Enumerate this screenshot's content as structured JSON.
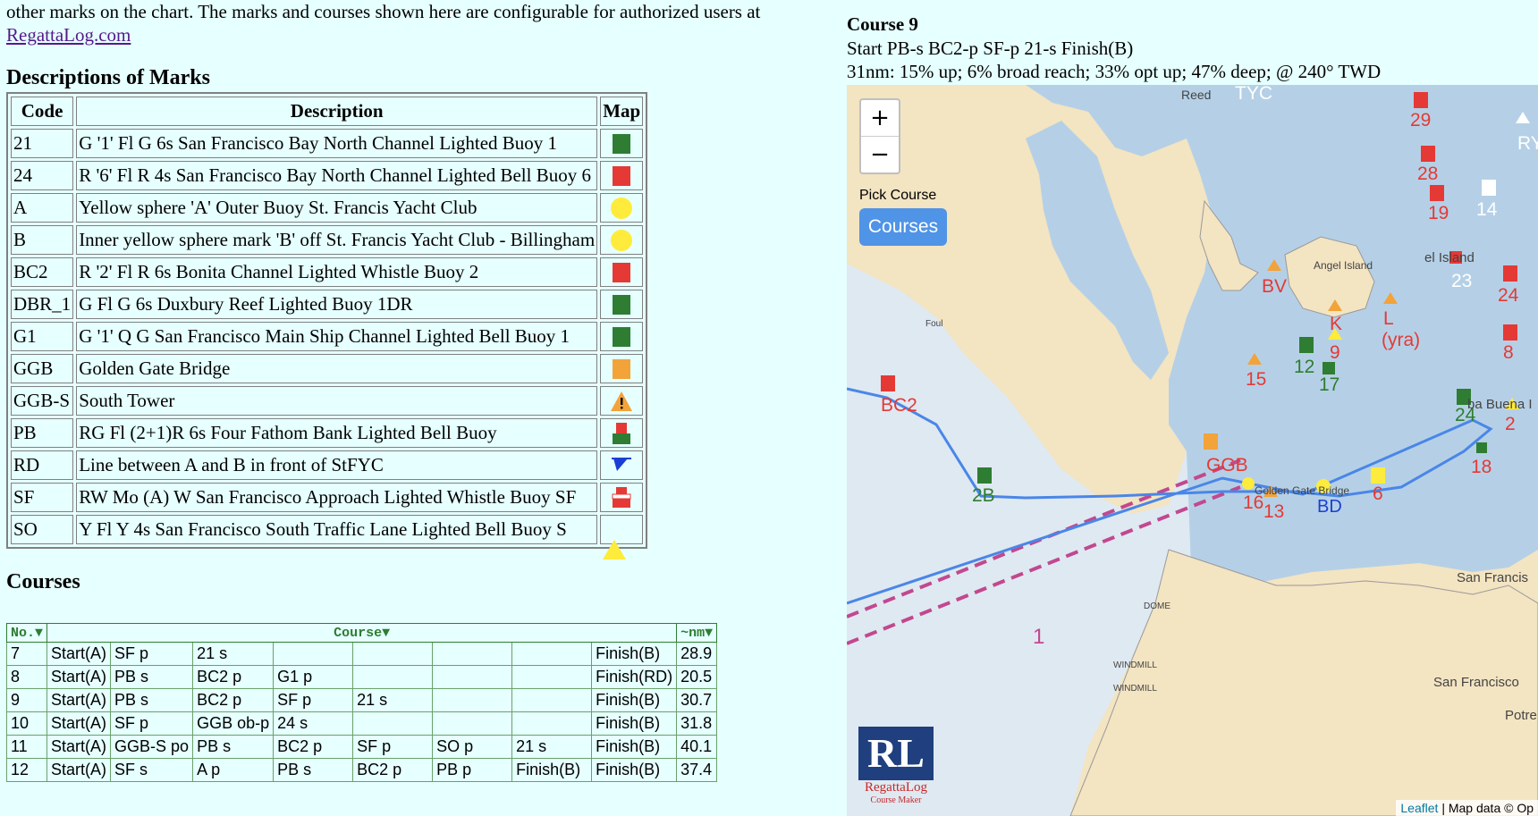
{
  "intro": {
    "line1": "other marks on the chart. The marks and courses shown here are configurable for authorized users at",
    "link": "RegattaLog.com"
  },
  "marks": {
    "heading": "Descriptions of Marks",
    "headers": [
      "Code",
      "Description",
      "Map"
    ],
    "rows": [
      {
        "code": "21",
        "desc": "G '1' Fl G 6s San Francisco Bay North Channel Lighted Buoy 1",
        "icon": "green-square-icon"
      },
      {
        "code": "24",
        "desc": "R '6' Fl R 4s San Francisco Bay North Channel Lighted Bell Buoy 6",
        "icon": "red-square-icon"
      },
      {
        "code": "A",
        "desc": "Yellow sphere 'A' Outer Buoy St. Francis Yacht Club",
        "icon": "yellow-circle-icon"
      },
      {
        "code": "B",
        "desc": "Inner yellow sphere mark 'B' off St. Francis Yacht Club - Billingham",
        "icon": "yellow-circle-icon"
      },
      {
        "code": "BC2",
        "desc": "R '2' Fl R 6s Bonita Channel Lighted Whistle Buoy 2",
        "icon": "red-square-icon"
      },
      {
        "code": "DBR_1",
        "desc": "G Fl G 6s Duxbury Reef Lighted Buoy 1DR",
        "icon": "green-square-icon"
      },
      {
        "code": "G1",
        "desc": "G '1' Q G San Francisco Main Ship Channel Lighted Bell Buoy 1",
        "icon": "green-square-icon"
      },
      {
        "code": "GGB",
        "desc": "Golden Gate Bridge",
        "icon": "orange-square-icon"
      },
      {
        "code": "GGB-S",
        "desc": "South Tower",
        "icon": "warning-triangle-icon"
      },
      {
        "code": "PB",
        "desc": "RG Fl (2+1)R 6s Four Fathom Bank Lighted Bell Buoy",
        "icon": "red-green-buoy-icon"
      },
      {
        "code": "RD",
        "desc": "Line between A and B in front of StFYC",
        "icon": "blue-flag-icon"
      },
      {
        "code": "SF",
        "desc": "RW Mo (A) W San Francisco Approach Lighted Whistle Buoy SF",
        "icon": "red-white-buoy-icon"
      },
      {
        "code": "SO",
        "desc": "Y Fl Y 4s San Francisco South Traffic Lane Lighted Bell Buoy S",
        "icon": "yellow-triangle-icon"
      }
    ]
  },
  "courses": {
    "heading": "Courses",
    "headers": [
      "No.▼",
      "Course▼",
      "~nm▼"
    ],
    "rows": [
      {
        "cells": [
          "7",
          "Start(A)",
          "SF p",
          "21 s",
          "",
          "",
          "",
          "",
          "Finish(B)",
          "28.9"
        ]
      },
      {
        "cells": [
          "8",
          "Start(A)",
          "PB s",
          "BC2 p",
          "G1 p",
          "",
          "",
          "",
          "Finish(RD)",
          "20.5"
        ]
      },
      {
        "cells": [
          "9",
          "Start(A)",
          "PB s",
          "BC2 p",
          "SF p",
          "21 s",
          "",
          "",
          "Finish(B)",
          "30.7"
        ]
      },
      {
        "cells": [
          "10",
          "Start(A)",
          "SF p",
          "GGB ob-p",
          "24 s",
          "",
          "",
          "",
          "Finish(B)",
          "31.8"
        ]
      },
      {
        "cells": [
          "11",
          "Start(A)",
          "GGB-S po",
          "PB s",
          "BC2 p",
          "SF p",
          "SO p",
          "21 s",
          "Finish(B)",
          "40.1"
        ]
      },
      {
        "cells": [
          "12",
          "Start(A)",
          "SF s",
          "A p",
          "PB s",
          "BC2 p",
          "PB p",
          "Finish(B)",
          "Finish(B)",
          "37.4"
        ]
      }
    ]
  },
  "course_detail": {
    "title": "Course 9",
    "sequence": "Start PB-s BC2-p SF-p 21-s Finish(B)",
    "stats": "31nm: 15% up; 6% broad reach; 33% opt up; 47% deep; @ 240° TWD"
  },
  "map": {
    "zoom_in": "+",
    "zoom_out": "−",
    "pick_label": "Pick Course",
    "courses_button": "Courses",
    "logo_mark": "RL",
    "logo_name": "RegattaLog",
    "logo_tag": "Course Maker",
    "attribution_link": "Leaflet",
    "attribution_text": "| Map data © Op",
    "labels": {
      "tyc": "TYC",
      "reed": "Reed",
      "m29": "29",
      "m28": "28",
      "m19": "19",
      "m14": "14",
      "ry": "RY",
      "island": "el Island",
      "angel": "Angel Island",
      "m23": "23",
      "m24": "24",
      "bv": "BV",
      "k": "K",
      "l": "L",
      "yra": "(yra)",
      "m9": "9",
      "m8": "8",
      "m12": "12",
      "m17": "17",
      "m15": "15",
      "bc2": "BC2",
      "m24b": "24",
      "yerba": "ba Buena I",
      "m2": "2",
      "m18": "18",
      "ggb": "GGB",
      "gate": "Golden Gate Bridge",
      "m16": "16",
      "m13": "13",
      "bd": "BD",
      "m6": "6",
      "m2b": "2B",
      "sanfran": "San Francis",
      "sanfran2": "San Francisco",
      "potre": "Potre",
      "dome": "DOME",
      "wind1": "WINDMILL",
      "wind2": "WINDMILL",
      "foul": "Foul",
      "ten": "1"
    }
  },
  "colors": {
    "water": "#b5d0e6",
    "land": "#f3e4c2",
    "course": "#4a86e8",
    "mark_red": "#e53935",
    "mark_green": "#2e7d32",
    "mark_orange": "#f2a33a",
    "mark_yellow": "#ffeb3b"
  }
}
